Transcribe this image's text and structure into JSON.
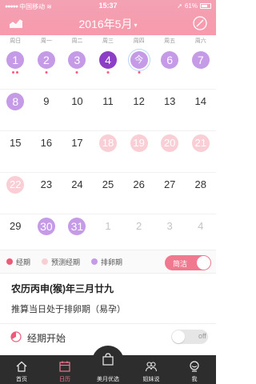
{
  "status": {
    "carrier": "中国移动",
    "time": "15:37",
    "battery": "61%"
  },
  "header": {
    "title": "2016年5月",
    "caret": "▾"
  },
  "weekdays": [
    "周日",
    "周一",
    "周二",
    "周三",
    "周四",
    "周五",
    "周六"
  ],
  "days": [
    [
      "1",
      "2",
      "3",
      "4",
      "今",
      "6",
      "7"
    ],
    [
      "8",
      "9",
      "10",
      "11",
      "12",
      "13",
      "14"
    ],
    [
      "15",
      "16",
      "17",
      "18",
      "19",
      "20",
      "21"
    ],
    [
      "22",
      "23",
      "24",
      "25",
      "26",
      "27",
      "28"
    ],
    [
      "29",
      "30",
      "31",
      "1",
      "2",
      "3",
      "4"
    ]
  ],
  "legend": {
    "period": "经期",
    "predicted": "预测经期",
    "ovulation": "排卵期",
    "toggle_label": "简洁"
  },
  "lunar": "农历丙申(猴)年三月廿九",
  "prediction": "推算当日处于排卵期（易孕）",
  "period_start": {
    "label": "经期开始",
    "toggle": "off"
  },
  "tabs": [
    "首页",
    "日历",
    "美月优选",
    "姐妹说",
    "我"
  ],
  "colors": {
    "header": "#f79aac",
    "ovulation": "#c59be8",
    "ovulation_dark": "#8c3fc4",
    "predicted": "#f9cfd5",
    "period": "#ec5b79",
    "tabbar": "#2d2d2d"
  }
}
